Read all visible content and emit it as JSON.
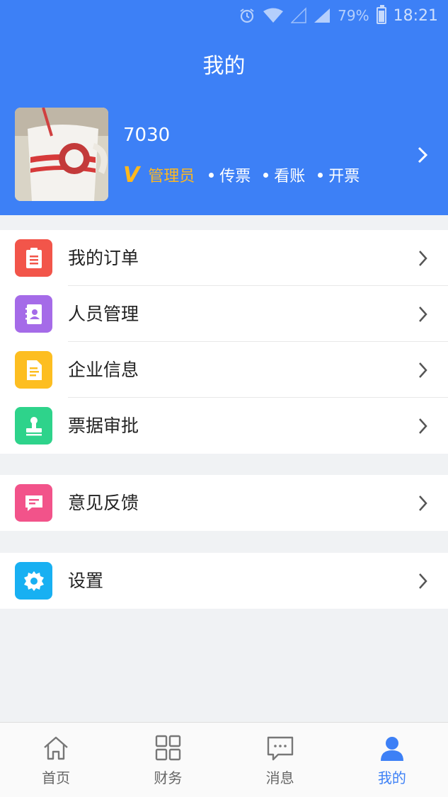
{
  "status_bar": {
    "battery": "79%",
    "time": "18:21"
  },
  "header": {
    "title": "我的"
  },
  "profile": {
    "username": "7030",
    "vip_badge": "V",
    "role": "管理员",
    "permissions": [
      "传票",
      "看账",
      "开票"
    ]
  },
  "menu_group_1": [
    {
      "label": "我的订单",
      "icon": "order-clipboard-icon",
      "color": "#f2554a"
    },
    {
      "label": "人员管理",
      "icon": "contacts-book-icon",
      "color": "#a56be8"
    },
    {
      "label": "企业信息",
      "icon": "document-icon",
      "color": "#fdbe21"
    },
    {
      "label": "票据审批",
      "icon": "stamp-icon",
      "color": "#2ed38b"
    }
  ],
  "menu_group_2": [
    {
      "label": "意见反馈",
      "icon": "feedback-message-icon",
      "color": "#f2538a"
    }
  ],
  "menu_group_3": [
    {
      "label": "设置",
      "icon": "settings-gear-icon",
      "color": "#18b0f2"
    }
  ],
  "tabbar": {
    "items": [
      {
        "label": "首页",
        "icon": "home-icon"
      },
      {
        "label": "财务",
        "icon": "grid-icon"
      },
      {
        "label": "消息",
        "icon": "chat-bubble-icon"
      },
      {
        "label": "我的",
        "icon": "user-icon"
      }
    ],
    "active": "我的"
  },
  "colors": {
    "brand": "#3d80f6",
    "role_gold": "#ffb81e"
  }
}
